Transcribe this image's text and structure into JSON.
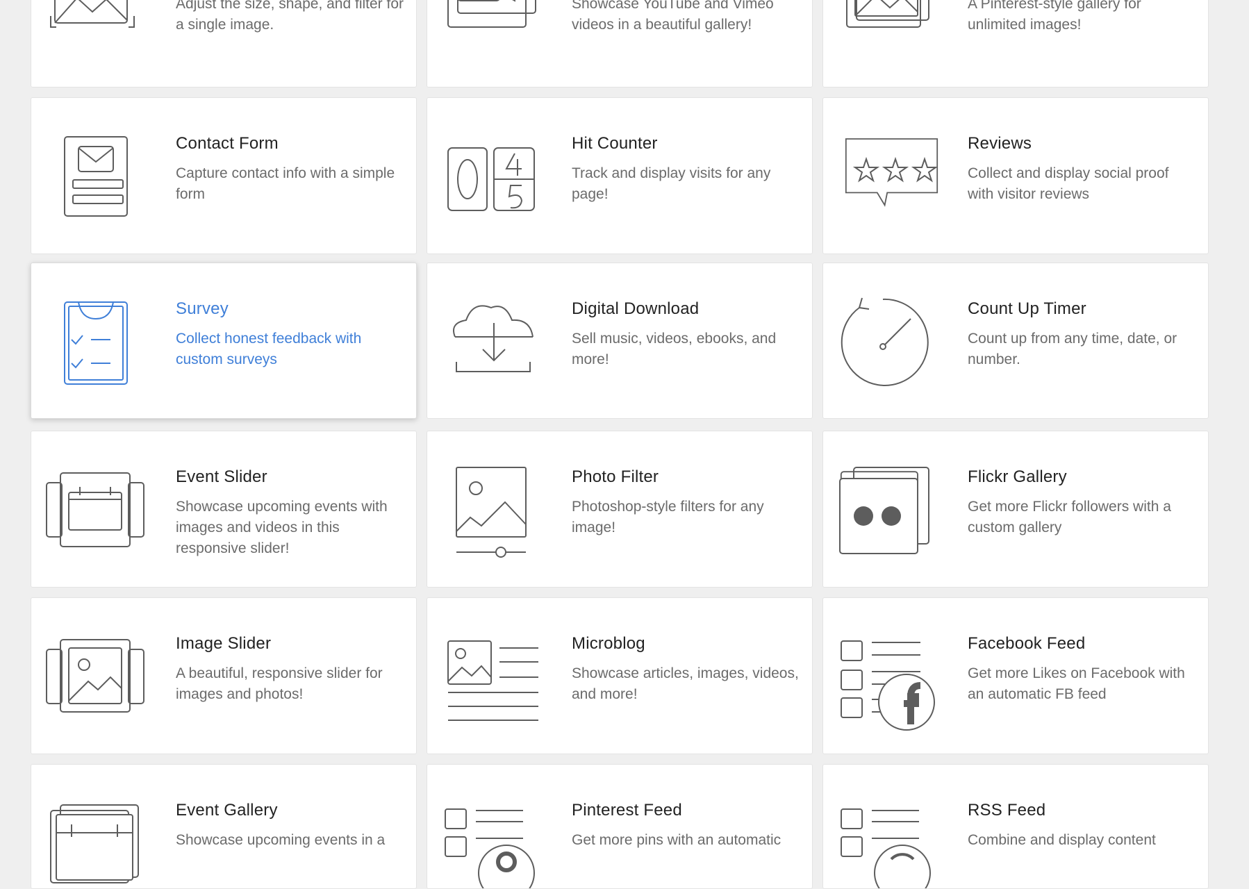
{
  "accent_color": "#3f7fd8",
  "cards": [
    {
      "title": "",
      "desc": "Adjust the size, shape, and filter for a single image.",
      "icon": "image-icon"
    },
    {
      "title": "",
      "desc": "Showcase YouTube and Vimeo videos in a beautiful gallery!",
      "icon": "video-gallery-icon"
    },
    {
      "title": "",
      "desc": "A Pinterest-style gallery for unlimited images!",
      "icon": "image-gallery-icon"
    },
    {
      "title": "Contact Form",
      "desc": "Capture contact info with a simple form",
      "icon": "contact-form-icon"
    },
    {
      "title": "Hit Counter",
      "desc": "Track and display visits for any page!",
      "icon": "hit-counter-icon"
    },
    {
      "title": "Reviews",
      "desc": "Collect and display social proof with visitor reviews",
      "icon": "reviews-icon"
    },
    {
      "title": "Survey",
      "desc": "Collect honest feedback with custom surveys",
      "icon": "survey-clipboard-icon",
      "selected": true
    },
    {
      "title": "Digital Download",
      "desc": "Sell music, videos, ebooks, and more!",
      "icon": "cloud-download-icon"
    },
    {
      "title": "Count Up Timer",
      "desc": "Count up from any time, date, or number.",
      "icon": "timer-dial-icon"
    },
    {
      "title": "Event Slider",
      "desc": "Showcase upcoming events with images and videos in this responsive slider!",
      "icon": "event-slider-icon"
    },
    {
      "title": "Photo Filter",
      "desc": "Photoshop-style filters for any image!",
      "icon": "photo-filter-icon"
    },
    {
      "title": "Flickr Gallery",
      "desc": "Get more Flickr followers with a custom gallery",
      "icon": "flickr-icon"
    },
    {
      "title": "Image Slider",
      "desc": "A beautiful, responsive slider for images and photos!",
      "icon": "image-slider-icon"
    },
    {
      "title": "Microblog",
      "desc": "Showcase articles, images, videos, and more!",
      "icon": "microblog-icon"
    },
    {
      "title": "Facebook Feed",
      "desc": "Get more Likes on Facebook with an automatic FB feed",
      "icon": "facebook-feed-icon"
    },
    {
      "title": "Event Gallery",
      "desc": "Showcase upcoming events in a",
      "icon": "event-gallery-icon"
    },
    {
      "title": "Pinterest Feed",
      "desc": "Get more pins with an automatic",
      "icon": "pinterest-feed-icon"
    },
    {
      "title": "RSS Feed",
      "desc": "Combine and display content",
      "icon": "rss-feed-icon"
    }
  ]
}
